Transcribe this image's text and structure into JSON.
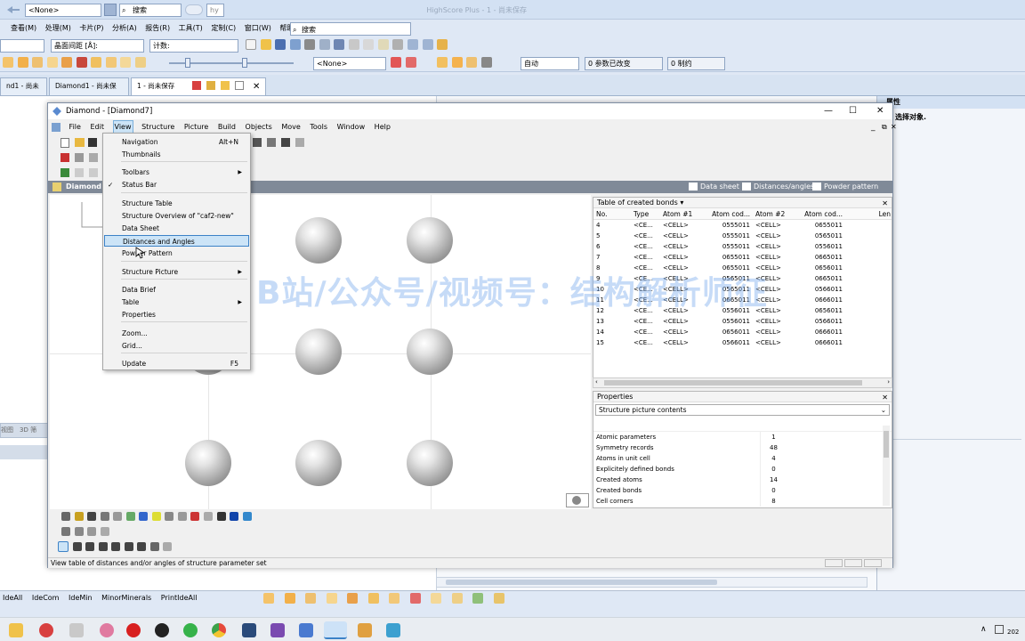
{
  "hs": {
    "title": "HighScore Plus - 1 - 尚未保存",
    "none_combo": "<None>",
    "search_label": "搜索",
    "user_label": "hy",
    "menu": [
      "查看(M)",
      "处理(M)",
      "卡片(P)",
      "分析(A)",
      "报告(R)",
      "工具(T)",
      "定制(C)",
      "窗口(W)",
      "帮助(H)"
    ],
    "search2": "搜索",
    "spacing_label": "晶面间距 [Å]:",
    "counts_label": "计数:",
    "none_combo2": "<None>",
    "auto_combo": "自动",
    "params_changed": "0 参数已改变",
    "constraints": "0 制约",
    "tabs": [
      "nd1 - 尚未保存",
      "Diamond1 - 尚未保存",
      "1 - 尚未保存"
    ],
    "right_panel_title": "属性",
    "right_panel_text": "选择对象.",
    "left_strip": [
      "视图",
      "3D 筛"
    ],
    "bottom_toolbar": [
      "IdeAll",
      "IdeCom",
      "IdeMin",
      "MinorMinerals",
      "PrintIdeAll"
    ]
  },
  "diamond": {
    "title": "Diamond - [Diamond7]",
    "menu": [
      "File",
      "Edit",
      "View",
      "Structure",
      "Picture",
      "Build",
      "Objects",
      "Move",
      "Tools",
      "Window",
      "Help"
    ],
    "doc_title": "Diamond",
    "doc_tabs": [
      "Data sheet",
      "Distances/angles",
      "Powder pattern"
    ],
    "status_text": "View table of distances and/or angles of structure parameter set"
  },
  "view_menu": {
    "items": [
      {
        "label": "Navigation",
        "shortcut": "Alt+N"
      },
      {
        "label": "Thumbnails"
      },
      {
        "label": "Toolbars",
        "submenu": true
      },
      {
        "label": "Status Bar",
        "checked": true
      },
      {
        "label": "Structure Table"
      },
      {
        "label": "Structure Overview of \"caf2-new\""
      },
      {
        "label": "Data Sheet"
      },
      {
        "label": "Distances and Angles",
        "highlighted": true
      },
      {
        "label": "Powder Pattern"
      },
      {
        "label": "Structure Picture",
        "submenu": true
      },
      {
        "label": "Data Brief"
      },
      {
        "label": "Table",
        "submenu": true
      },
      {
        "label": "Properties"
      },
      {
        "label": "Zoom..."
      },
      {
        "label": "Grid..."
      },
      {
        "label": "Update",
        "shortcut": "F5"
      }
    ]
  },
  "bonds_table": {
    "title": "Table of created bonds",
    "columns": [
      "No.",
      "Type",
      "Atom #1",
      "Atom cod...",
      "Atom #2",
      "Atom cod...",
      "Len"
    ],
    "rows": [
      [
        "4",
        "<CE...",
        "<CELL>",
        "0555011",
        "<CELL>",
        "0655011"
      ],
      [
        "5",
        "<CE...",
        "<CELL>",
        "0555011",
        "<CELL>",
        "0565011"
      ],
      [
        "6",
        "<CE...",
        "<CELL>",
        "0555011",
        "<CELL>",
        "0556011"
      ],
      [
        "7",
        "<CE...",
        "<CELL>",
        "0655011",
        "<CELL>",
        "0665011"
      ],
      [
        "8",
        "<CE...",
        "<CELL>",
        "0655011",
        "<CELL>",
        "0656011"
      ],
      [
        "9",
        "<CE...",
        "<CELL>",
        "0565011",
        "<CELL>",
        "0665011"
      ],
      [
        "10",
        "<CE...",
        "<CELL>",
        "0565011",
        "<CELL>",
        "0566011"
      ],
      [
        "11",
        "<CE...",
        "<CELL>",
        "0665011",
        "<CELL>",
        "0666011"
      ],
      [
        "12",
        "<CE...",
        "<CELL>",
        "0556011",
        "<CELL>",
        "0656011"
      ],
      [
        "13",
        "<CE...",
        "<CELL>",
        "0556011",
        "<CELL>",
        "0566011"
      ],
      [
        "14",
        "<CE...",
        "<CELL>",
        "0656011",
        "<CELL>",
        "0666011"
      ],
      [
        "15",
        "<CE...",
        "<CELL>",
        "0566011",
        "<CELL>",
        "0666011"
      ]
    ]
  },
  "properties": {
    "title": "Properties",
    "selector": "Structure picture contents",
    "rows": [
      [
        "Atomic parameters",
        "1"
      ],
      [
        "Symmetry records",
        "48"
      ],
      [
        "Atoms in unit cell",
        "4"
      ],
      [
        "Explicitely defined bonds",
        "0"
      ],
      [
        "Created atoms",
        "14"
      ],
      [
        "Created bonds",
        "0"
      ],
      [
        "Cell corners",
        "8"
      ]
    ]
  },
  "watermark": "B站/公众号/视频号：结构解析师征",
  "clock": "202"
}
